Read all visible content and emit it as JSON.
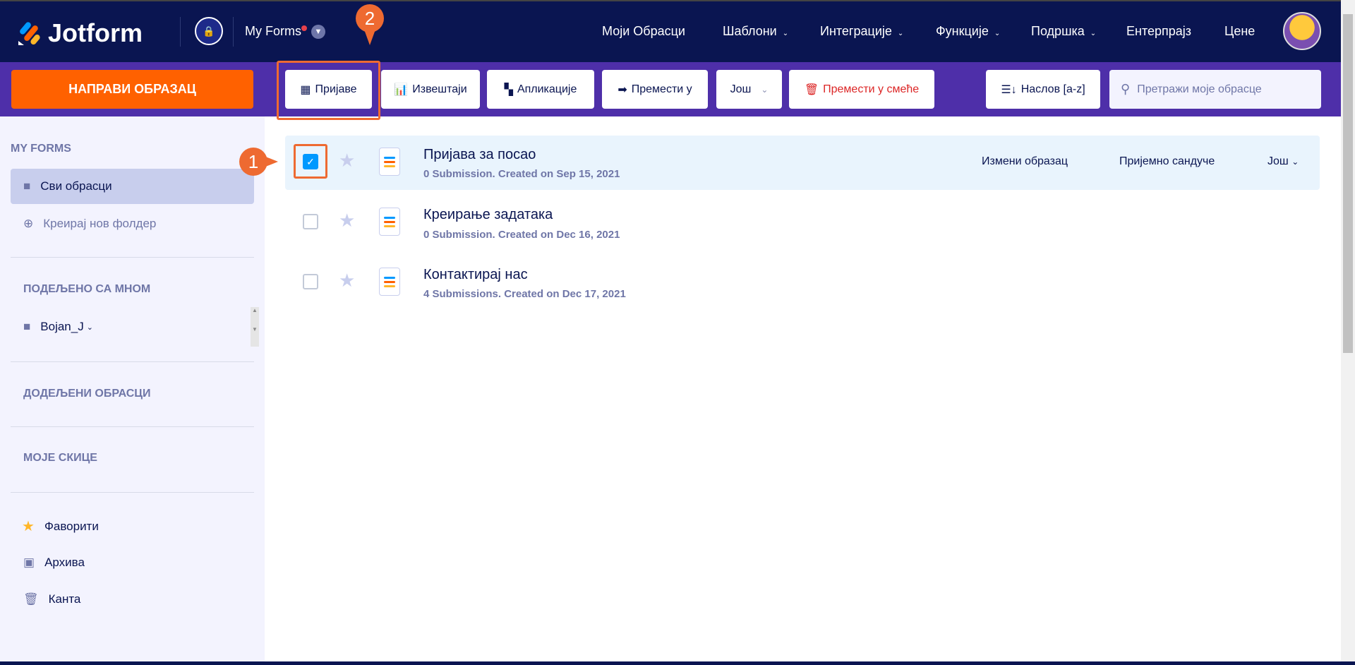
{
  "header": {
    "logo": "Jotform",
    "my_forms": "My Forms",
    "nav": [
      {
        "label": "Моји Обрасци",
        "dropdown": false
      },
      {
        "label": "Шаблони",
        "dropdown": true
      },
      {
        "label": "Интеграције",
        "dropdown": true
      },
      {
        "label": "Функције",
        "dropdown": true
      },
      {
        "label": "Подршка",
        "dropdown": true
      },
      {
        "label": "Ентерпрајз",
        "dropdown": false
      },
      {
        "label": "Цене",
        "dropdown": false
      }
    ]
  },
  "toolbar": {
    "create": "НАПРАВИ ОБРАЗАЦ",
    "submissions": "Пријаве",
    "reports": "Извештаји",
    "apps": "Апликације",
    "move_to": "Премести у",
    "more": "Још",
    "trash": "Премести у смеће",
    "sort": "Наслов [a-z]",
    "search_placeholder": "Претражи моје обрасце"
  },
  "sidebar": {
    "my_forms": "MY FORMS",
    "all_forms": "Сви обрасци",
    "new_folder": "Креирај нов фолдер",
    "shared": "ПОДЕЉЕНО СА МНОМ",
    "shared_user": "Bojan_J",
    "assigned": "ДОДЕЉЕНИ ОБРАСЦИ",
    "drafts": "МОЈЕ СКИЦЕ",
    "favorites": "Фаворити",
    "archive": "Архива",
    "trash": "Канта"
  },
  "forms": [
    {
      "title": "Пријава за посао",
      "sub": "0 Submission. Created on Sep 15, 2021",
      "selected": true
    },
    {
      "title": "Креирање задатака",
      "sub": "0 Submission. Created on Dec 16, 2021",
      "selected": false
    },
    {
      "title": "Контактирај нас",
      "sub": "4 Submissions. Created on Dec 17, 2021",
      "selected": false
    }
  ],
  "row_actions": {
    "edit": "Измени образац",
    "inbox": "Пријемно сандуче",
    "more": "Још"
  },
  "annotations": {
    "step1": "1",
    "step2": "2"
  },
  "colors": {
    "accent": "#ff6100",
    "header": "#0a1551",
    "toolbar": "#4e2fa9",
    "annotation": "#ee6a31"
  }
}
